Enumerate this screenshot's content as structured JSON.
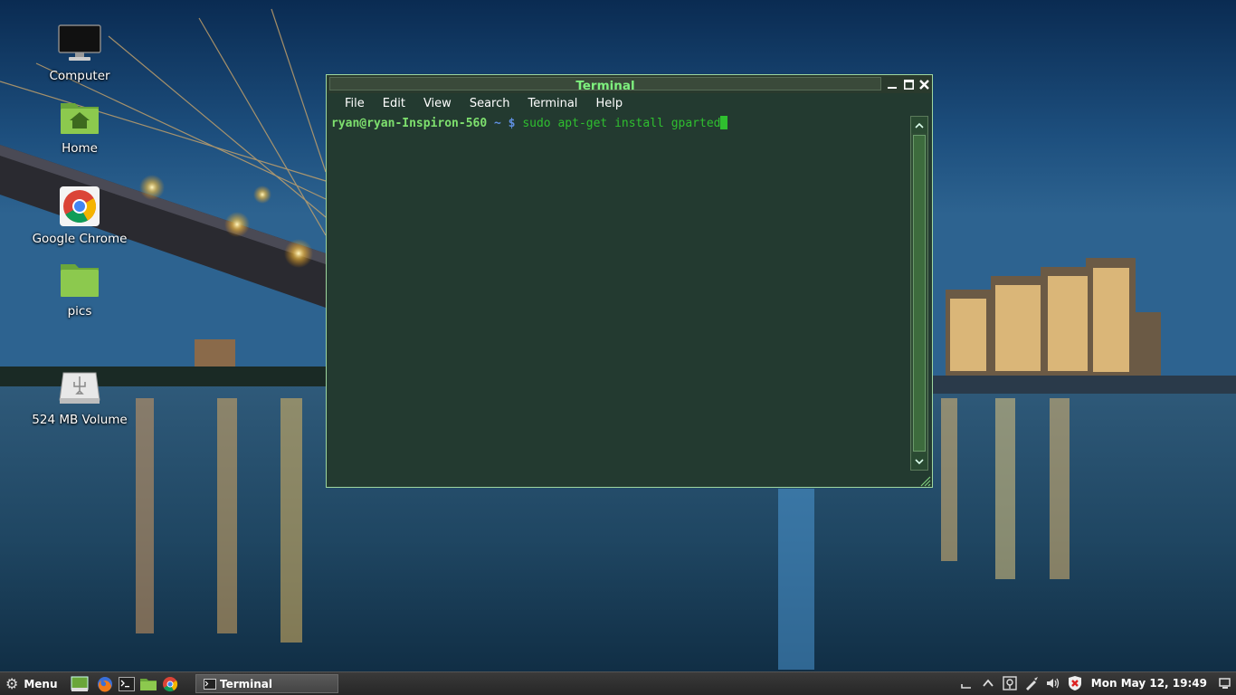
{
  "desktop": {
    "icons": [
      {
        "label": "Computer",
        "icon": "monitor-icon"
      },
      {
        "label": "Home",
        "icon": "home-folder-icon"
      },
      {
        "label": "Google Chrome",
        "icon": "chrome-icon"
      },
      {
        "label": "pics",
        "icon": "folder-icon"
      },
      {
        "label": "524 MB Volume",
        "icon": "usb-drive-icon"
      }
    ]
  },
  "terminal": {
    "title": "Terminal",
    "menu": [
      "File",
      "Edit",
      "View",
      "Search",
      "Terminal",
      "Help"
    ],
    "prompt_user": "ryan@ryan-Inspiron-560",
    "prompt_path": "~ $",
    "command": "sudo apt-get install gparted",
    "colors": {
      "border": "#9fd79f",
      "title": "#7ef07e",
      "background": "#233a30",
      "command": "#2fbf2f"
    }
  },
  "taskbar": {
    "menu_label": "Menu",
    "launchers": [
      "show-desktop-icon",
      "firefox-icon",
      "terminal-icon",
      "files-icon",
      "chrome-icon"
    ],
    "tasks": [
      {
        "label": "Terminal",
        "icon": "terminal-icon"
      }
    ],
    "tray": [
      "window-list-icon",
      "arrow-up-icon",
      "network-icon",
      "pen-icon",
      "volume-icon",
      "shield-icon"
    ],
    "clock": "Mon May 12, 19:49"
  }
}
